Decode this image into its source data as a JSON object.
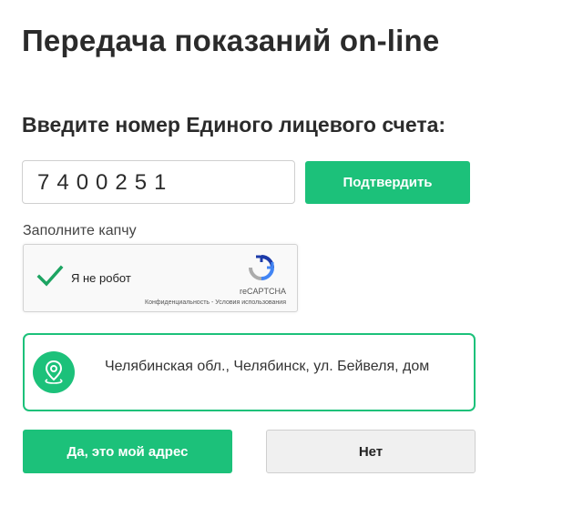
{
  "page": {
    "title": "Передача показаний on-line"
  },
  "account": {
    "heading": "Введите номер Единого лицевого счета:",
    "value": "7400251",
    "confirm_label": "Подтвердить"
  },
  "captcha": {
    "label": "Заполните капчу",
    "checkbox_label": "Я не робот",
    "checked": true,
    "brand": "reCAPTCHA",
    "privacy_link": "Конфиденциальность",
    "separator": " - ",
    "terms_link": "Условия использования"
  },
  "address": {
    "text": "Челябинская обл., Челябинск, ул. Бейвеля, дом",
    "icon": "location-pin-icon"
  },
  "actions": {
    "yes_label": "Да, это мой адрес",
    "no_label": "Нет"
  },
  "colors": {
    "accent": "#1cc17a",
    "secondary_button": "#f0f0f0",
    "text": "#2b2b2b"
  }
}
